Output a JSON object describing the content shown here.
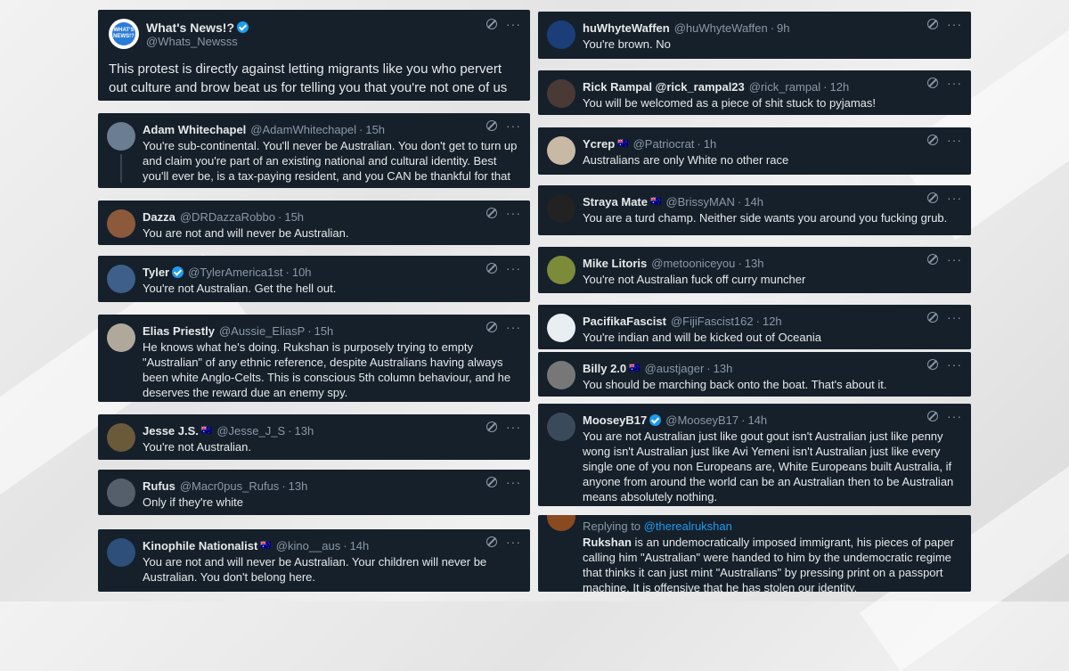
{
  "main_tweet": {
    "name": "What's News!?",
    "handle": "@Whats_Newsss",
    "avatar_text": "WHAT'S NEWS!?",
    "text": "This protest is directly against letting migrants like you who pervert out culture and brow beat us for telling you that you're not one of us ffs."
  },
  "more_glyph": "···",
  "replies_left": [
    {
      "name": "Adam Whitechapel",
      "handle": "@AdamWhitechapel",
      "time": "15h",
      "verified": false,
      "flag": "",
      "text": "You're sub-continental. You'll never be Australian. You don't get to turn up and claim you're part of an existing national and cultural identity. Best you'll ever be, is a tax-paying resident, and you CAN be thankful for that"
    },
    {
      "name": "Dazza",
      "handle": "@DRDazzaRobbo",
      "time": "15h",
      "verified": false,
      "flag": "",
      "text": "You are not and will never be Australian."
    },
    {
      "name": "Tyler",
      "handle": "@TylerAmerica1st",
      "time": "10h",
      "verified": true,
      "flag": "",
      "text": "You're not Australian. Get the hell out."
    },
    {
      "name": "Elias Priestly",
      "handle": "@Aussie_EliasP",
      "time": "15h",
      "verified": false,
      "flag": "",
      "text": "He knows what he's doing. Rukshan is purposely trying to empty \"Australian\" of any ethnic reference, despite Australians having always been white Anglo-Celts. This is conscious 5th column behaviour, and he deserves the reward due an enemy spy."
    },
    {
      "name": "Jesse J.S.",
      "handle": "@Jesse_J_S",
      "time": "13h",
      "verified": false,
      "flag": "🇦🇺",
      "text": "You're not Australian."
    },
    {
      "name": "Rufus",
      "handle": "@Macr0pus_Rufus",
      "time": "13h",
      "verified": false,
      "flag": "",
      "text": "Only if they're white"
    },
    {
      "name": "Kinophile Nationalist",
      "handle": "@kino__aus",
      "time": "14h",
      "verified": false,
      "flag": "🇦🇺",
      "text": "You are not and will never be Australian. Your children will never be Australian. You don't belong here."
    }
  ],
  "replies_right": [
    {
      "name": "huWhyteWaffen",
      "handle": "@huWhyteWaffen",
      "time": "9h",
      "verified": false,
      "flag": "",
      "text": "You're brown. No"
    },
    {
      "name": "Rick Rampal @rick_rampal23",
      "handle": "@rick_rampal",
      "time": "12h",
      "verified": false,
      "flag": "",
      "text": "You will be welcomed as a piece of shit stuck to pyjamas!"
    },
    {
      "name": "Ycrep",
      "handle": "@Patriocrat",
      "time": "1h",
      "verified": false,
      "flag": "🇦🇺",
      "text": "Australians are only White no other race"
    },
    {
      "name": "Straya Mate",
      "handle": "@BrissyMAN",
      "time": "14h",
      "verified": false,
      "flag": "🇦🇺",
      "text": "You are a turd champ. Neither side wants you around you fucking grub."
    },
    {
      "name": "Mike Litoris",
      "handle": "@metooniceyou",
      "time": "13h",
      "verified": false,
      "flag": "",
      "text": "You're not Australian fuck off curry muncher"
    },
    {
      "name": "PacifikaFascist",
      "handle": "@FijiFascist162",
      "time": "12h",
      "verified": false,
      "flag": "",
      "text": "You're indian and will be kicked out of Oceania"
    },
    {
      "name": "Billy 2.0",
      "handle": "@austjager",
      "time": "13h",
      "verified": false,
      "flag": "🇦🇺",
      "text": "You should be marching back onto the boat. That's about it."
    },
    {
      "name": "MooseyB17",
      "handle": "@MooseyB17",
      "time": "14h",
      "verified": true,
      "flag": "",
      "text": "You are not Australian just like gout gout isn't Australian just like penny wong isn't Australian just like Avi Yemeni isn't Australian just like every single one of you non Europeans are, White Europeans built Australia, if anyone from around the world can be an Australian then to be Australian means absolutely nothing."
    }
  ],
  "last_reply": {
    "replying_label": "Replying to",
    "replying_handle": "@therealrukshan",
    "bold_word": "Rukshan",
    "text": " is an undemocratically imposed immigrant, his pieces of paper calling him \"Australian\" were handed to him by the undemocratic regime that thinks it can just mint \"Australians\" by pressing print on a passport machine. It is offensive that he has stolen our identity."
  },
  "colors": {
    "card_bg": "#15202b",
    "text": "#e7e9ea",
    "muted": "#8b98a5",
    "verified": "#1d9bf0"
  }
}
